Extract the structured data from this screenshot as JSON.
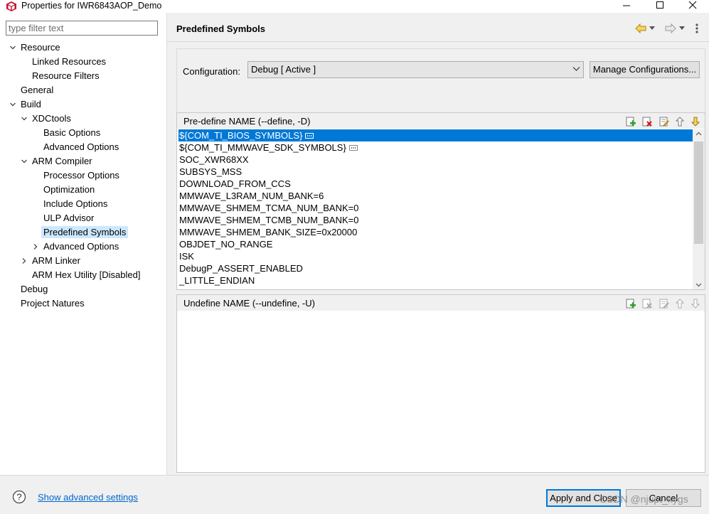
{
  "window": {
    "title": "Properties for IWR6843AOP_Demo",
    "icon": "ccs-cube-icon",
    "accent_color": "#0078d7"
  },
  "filter": {
    "placeholder": "type filter text",
    "value": ""
  },
  "tree": [
    {
      "label": "Resource",
      "expanded": true
    },
    {
      "label": "Linked Resources"
    },
    {
      "label": "Resource Filters"
    },
    {
      "label": "General"
    },
    {
      "label": "Build",
      "expanded": true
    },
    {
      "label": "XDCtools",
      "expanded": true
    },
    {
      "label": "Basic Options"
    },
    {
      "label": "Advanced Options"
    },
    {
      "label": "ARM Compiler",
      "expanded": true
    },
    {
      "label": "Processor Options"
    },
    {
      "label": "Optimization"
    },
    {
      "label": "Include Options"
    },
    {
      "label": "ULP Advisor"
    },
    {
      "label": "Predefined Symbols",
      "selected": true
    },
    {
      "label": "Advanced Options",
      "expanded": false
    },
    {
      "label": "ARM Linker",
      "expanded": false
    },
    {
      "label": "ARM Hex Utility  [Disabled]"
    },
    {
      "label": "Debug"
    },
    {
      "label": "Project Natures"
    }
  ],
  "page": {
    "title": "Predefined Symbols"
  },
  "configuration": {
    "label": "Configuration:",
    "value": "Debug  [ Active ]",
    "manage_label": "Manage Configurations..."
  },
  "predefine": {
    "caption": "Pre-define NAME (--define, -D)",
    "items": [
      {
        "text": "${COM_TI_BIOS_SYMBOLS}",
        "has_dots": true,
        "selected": true
      },
      {
        "text": "${COM_TI_MMWAVE_SDK_SYMBOLS}",
        "has_dots": true
      },
      {
        "text": "SOC_XWR68XX"
      },
      {
        "text": "SUBSYS_MSS"
      },
      {
        "text": "DOWNLOAD_FROM_CCS"
      },
      {
        "text": "MMWAVE_L3RAM_NUM_BANK=6"
      },
      {
        "text": "MMWAVE_SHMEM_TCMA_NUM_BANK=0"
      },
      {
        "text": "MMWAVE_SHMEM_TCMB_NUM_BANK=0"
      },
      {
        "text": "MMWAVE_SHMEM_BANK_SIZE=0x20000"
      },
      {
        "text": "OBJDET_NO_RANGE"
      },
      {
        "text": "ISK"
      },
      {
        "text": "DebugP_ASSERT_ENABLED"
      },
      {
        "text": "_LITTLE_ENDIAN"
      }
    ]
  },
  "undefine": {
    "caption": "Undefine NAME (--undefine, -U)",
    "items": []
  },
  "footer": {
    "advanced_link": "Show advanced settings",
    "apply_close": "Apply and Close",
    "cancel": "Cancel",
    "watermark": "CSDN @njupt_kygs"
  }
}
